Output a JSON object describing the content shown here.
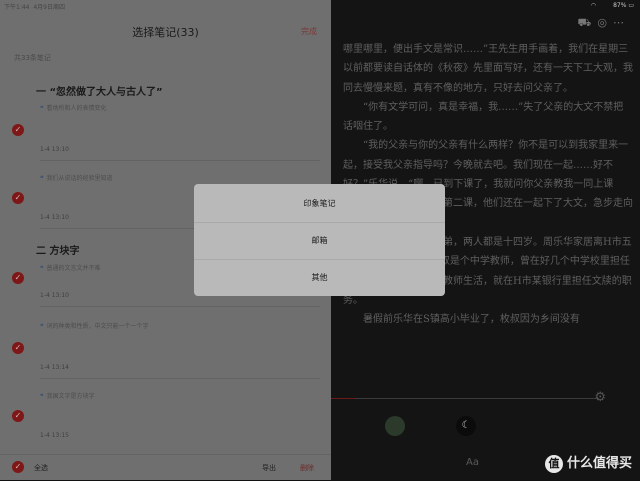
{
  "status": {
    "time": "下午1:44",
    "date": "4月9日周四",
    "battery": "87%"
  },
  "notes": {
    "title": "选择笔记(33)",
    "done": "完成",
    "count": "共33条笔记",
    "sections": [
      {
        "title": "一 “忽然做了大人与古人了”"
      },
      {
        "title": "二 方块字"
      }
    ],
    "items": [
      {
        "text": "看场所和人的表情变化",
        "date": "1-4 13:10"
      },
      {
        "text": "我们从说话的经验里知道",
        "date": "1-4 13:10"
      },
      {
        "text": "普通的文言文并不难",
        "date": "1-4 13:10"
      },
      {
        "text": "词的种类和性质，中文只能一个一个字",
        "date": "1-4 13:14"
      },
      {
        "text": "我国文字是方块字",
        "date": "1-4 13:15"
      }
    ],
    "select_all": "全选",
    "export": "导出",
    "delete": "删除"
  },
  "reader": {
    "paragraphs": [
      "哪里哪里，便出手文是常识……”王先生用手画着，我们在星期三以前都要读自话体的《秋夜》先里面写好，还有一天下工大观，我同去慢慢来题，真有不像的地方，只好去问父亲了。",
      "“你有文学可问，真是幸福，我……”失了父亲的大文不禁把话咽住了。",
      "“我的父亲与你的父亲有什么两样？你不是可以到我家里来一起，接受我父亲指导吗？今晚就去吧。我们现在一起……好不好？”乐华说，“啊，已到下课了，我就问你父亲教我一同上课去。下午第一课，下午第二课，他们还在一起下了大文，急步走向自己家里去。”",
      "乐华与大文是表兄弟，两人都是十四岁。周乐华家居离H市五十里的S镇，父亲周枚叔是个中学教师，曾在好几个中学校里担任国文课，新近因为厌弃教师生活，就在H市某银行里担任文牍的职务。",
      "暑假前乐华在S镇高小毕业了，枚叔因为乡间没有"
    ],
    "font_label": "Aa"
  },
  "dialog": {
    "options": [
      "印象笔记",
      "邮箱",
      "其他"
    ]
  },
  "watermark": {
    "badge": "值",
    "text": "什么值得买"
  }
}
